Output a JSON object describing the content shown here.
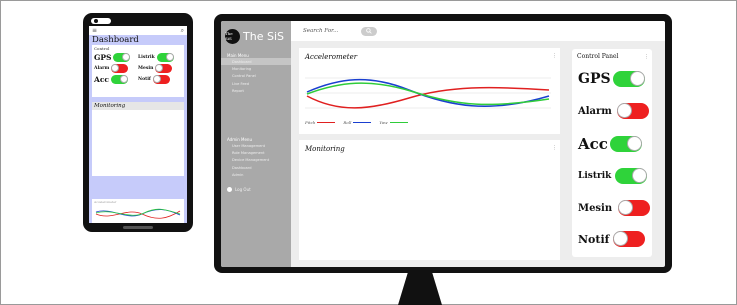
{
  "phone": {
    "dashboard_title": "Dashboard",
    "control_label": "Control",
    "toggles": [
      {
        "name": "GPS",
        "state": "on"
      },
      {
        "name": "Listrik",
        "state": "on"
      },
      {
        "name": "Alarm",
        "state": "off"
      },
      {
        "name": "Mesin",
        "state": "off"
      },
      {
        "name": "Acc",
        "state": "on"
      },
      {
        "name": "Notif",
        "state": "off"
      }
    ],
    "monitoring_title": "Monitoring",
    "chart_label": "Accelerometer"
  },
  "app": {
    "brand_logo_text": "The SiS",
    "brand_name": "The SiS",
    "search_placeholder": "Search For...",
    "menu_main_header": "Main Menu",
    "menu_main": [
      "Dashboard",
      "Monitoring",
      "Control Panel",
      "Live Feed",
      "Report"
    ],
    "menu_admin_header": "Admin Menu",
    "menu_admin": [
      "User Management",
      "Role Management",
      "Device Management",
      "Dashboard",
      "Admin"
    ],
    "logout_label": "Log Out",
    "accelerometer_title": "Accelerometer",
    "monitoring_title": "Monitoring",
    "control_panel_title": "Control Panel",
    "controls": [
      {
        "name": "GPS",
        "state": "on"
      },
      {
        "name": "Alarm",
        "state": "off"
      },
      {
        "name": "Acc",
        "state": "on"
      },
      {
        "name": "Listrik",
        "state": "on"
      },
      {
        "name": "Mesin",
        "state": "off"
      },
      {
        "name": "Notif",
        "state": "off"
      }
    ]
  },
  "colors": {
    "on": "#2fd33a",
    "off": "#ee2020",
    "pitch": "#e02020",
    "roll": "#1a3fd0",
    "yaw": "#2fcc3a"
  },
  "chart_data": {
    "type": "line",
    "title": "Accelerometer",
    "series": [
      {
        "name": "Pitch",
        "color": "#e02020"
      },
      {
        "name": "Roll",
        "color": "#1a3fd0"
      },
      {
        "name": "Yaw",
        "color": "#2fcc3a"
      }
    ]
  }
}
